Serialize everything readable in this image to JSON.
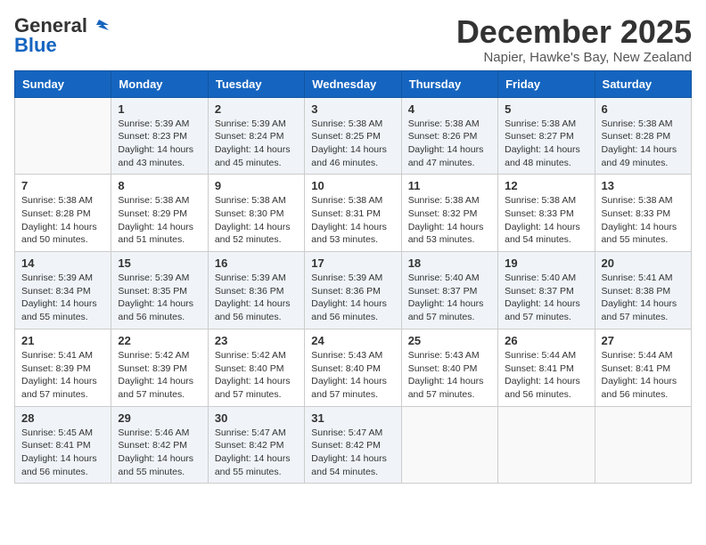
{
  "header": {
    "logo_general": "General",
    "logo_blue": "Blue",
    "month_title": "December 2025",
    "location": "Napier, Hawke's Bay, New Zealand"
  },
  "weekdays": [
    "Sunday",
    "Monday",
    "Tuesday",
    "Wednesday",
    "Thursday",
    "Friday",
    "Saturday"
  ],
  "weeks": [
    [
      {
        "day": "",
        "empty": true
      },
      {
        "day": "1",
        "sunrise": "5:39 AM",
        "sunset": "8:23 PM",
        "daylight": "14 hours and 43 minutes."
      },
      {
        "day": "2",
        "sunrise": "5:39 AM",
        "sunset": "8:24 PM",
        "daylight": "14 hours and 45 minutes."
      },
      {
        "day": "3",
        "sunrise": "5:38 AM",
        "sunset": "8:25 PM",
        "daylight": "14 hours and 46 minutes."
      },
      {
        "day": "4",
        "sunrise": "5:38 AM",
        "sunset": "8:26 PM",
        "daylight": "14 hours and 47 minutes."
      },
      {
        "day": "5",
        "sunrise": "5:38 AM",
        "sunset": "8:27 PM",
        "daylight": "14 hours and 48 minutes."
      },
      {
        "day": "6",
        "sunrise": "5:38 AM",
        "sunset": "8:28 PM",
        "daylight": "14 hours and 49 minutes."
      }
    ],
    [
      {
        "day": "7",
        "sunrise": "5:38 AM",
        "sunset": "8:28 PM",
        "daylight": "14 hours and 50 minutes."
      },
      {
        "day": "8",
        "sunrise": "5:38 AM",
        "sunset": "8:29 PM",
        "daylight": "14 hours and 51 minutes."
      },
      {
        "day": "9",
        "sunrise": "5:38 AM",
        "sunset": "8:30 PM",
        "daylight": "14 hours and 52 minutes."
      },
      {
        "day": "10",
        "sunrise": "5:38 AM",
        "sunset": "8:31 PM",
        "daylight": "14 hours and 53 minutes."
      },
      {
        "day": "11",
        "sunrise": "5:38 AM",
        "sunset": "8:32 PM",
        "daylight": "14 hours and 53 minutes."
      },
      {
        "day": "12",
        "sunrise": "5:38 AM",
        "sunset": "8:33 PM",
        "daylight": "14 hours and 54 minutes."
      },
      {
        "day": "13",
        "sunrise": "5:38 AM",
        "sunset": "8:33 PM",
        "daylight": "14 hours and 55 minutes."
      }
    ],
    [
      {
        "day": "14",
        "sunrise": "5:39 AM",
        "sunset": "8:34 PM",
        "daylight": "14 hours and 55 minutes."
      },
      {
        "day": "15",
        "sunrise": "5:39 AM",
        "sunset": "8:35 PM",
        "daylight": "14 hours and 56 minutes."
      },
      {
        "day": "16",
        "sunrise": "5:39 AM",
        "sunset": "8:36 PM",
        "daylight": "14 hours and 56 minutes."
      },
      {
        "day": "17",
        "sunrise": "5:39 AM",
        "sunset": "8:36 PM",
        "daylight": "14 hours and 56 minutes."
      },
      {
        "day": "18",
        "sunrise": "5:40 AM",
        "sunset": "8:37 PM",
        "daylight": "14 hours and 57 minutes."
      },
      {
        "day": "19",
        "sunrise": "5:40 AM",
        "sunset": "8:37 PM",
        "daylight": "14 hours and 57 minutes."
      },
      {
        "day": "20",
        "sunrise": "5:41 AM",
        "sunset": "8:38 PM",
        "daylight": "14 hours and 57 minutes."
      }
    ],
    [
      {
        "day": "21",
        "sunrise": "5:41 AM",
        "sunset": "8:39 PM",
        "daylight": "14 hours and 57 minutes."
      },
      {
        "day": "22",
        "sunrise": "5:42 AM",
        "sunset": "8:39 PM",
        "daylight": "14 hours and 57 minutes."
      },
      {
        "day": "23",
        "sunrise": "5:42 AM",
        "sunset": "8:40 PM",
        "daylight": "14 hours and 57 minutes."
      },
      {
        "day": "24",
        "sunrise": "5:43 AM",
        "sunset": "8:40 PM",
        "daylight": "14 hours and 57 minutes."
      },
      {
        "day": "25",
        "sunrise": "5:43 AM",
        "sunset": "8:40 PM",
        "daylight": "14 hours and 57 minutes."
      },
      {
        "day": "26",
        "sunrise": "5:44 AM",
        "sunset": "8:41 PM",
        "daylight": "14 hours and 56 minutes."
      },
      {
        "day": "27",
        "sunrise": "5:44 AM",
        "sunset": "8:41 PM",
        "daylight": "14 hours and 56 minutes."
      }
    ],
    [
      {
        "day": "28",
        "sunrise": "5:45 AM",
        "sunset": "8:41 PM",
        "daylight": "14 hours and 56 minutes."
      },
      {
        "day": "29",
        "sunrise": "5:46 AM",
        "sunset": "8:42 PM",
        "daylight": "14 hours and 55 minutes."
      },
      {
        "day": "30",
        "sunrise": "5:47 AM",
        "sunset": "8:42 PM",
        "daylight": "14 hours and 55 minutes."
      },
      {
        "day": "31",
        "sunrise": "5:47 AM",
        "sunset": "8:42 PM",
        "daylight": "14 hours and 54 minutes."
      },
      {
        "day": "",
        "empty": true
      },
      {
        "day": "",
        "empty": true
      },
      {
        "day": "",
        "empty": true
      }
    ]
  ],
  "labels": {
    "sunrise": "Sunrise:",
    "sunset": "Sunset:",
    "daylight": "Daylight:"
  }
}
